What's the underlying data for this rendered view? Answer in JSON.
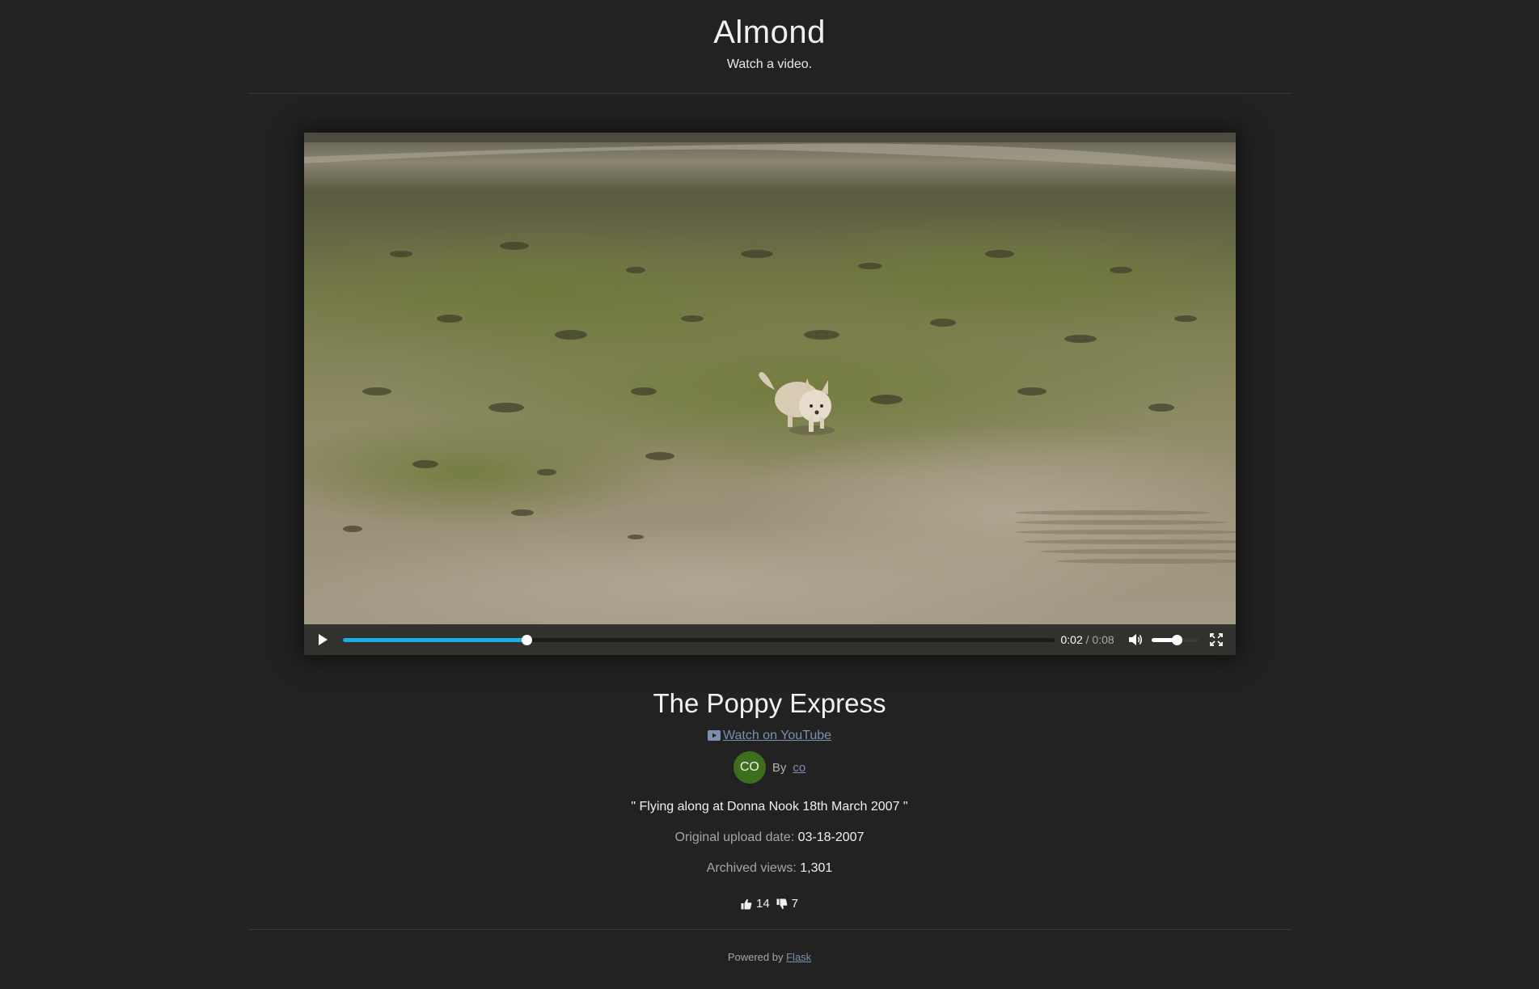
{
  "site": {
    "title": "Almond",
    "tagline": "Watch a video."
  },
  "player": {
    "current_time": "0:02",
    "separator": "/",
    "duration": "0:08",
    "progress_fraction": 0.259,
    "volume_fraction": 0.55,
    "icons": [
      "play-icon",
      "volume-icon",
      "fullscreen-icon"
    ],
    "accent_color": "#1cade4"
  },
  "video": {
    "title": "The Poppy Express",
    "youtube_link": "Watch on YouTube",
    "author_initials": "CO",
    "by_label": "By",
    "author": "co",
    "description": "\" Flying along at Donna Nook 18th March 2007 \"",
    "upload_label": "Original upload date:",
    "upload_date": "03-18-2007",
    "views_label": "Archived views:",
    "views": "1,301",
    "likes": "14",
    "dislikes": "7",
    "avatar_color": "#3d6e1c"
  },
  "footer": {
    "powered_by": "Powered by",
    "framework": "Flask"
  }
}
